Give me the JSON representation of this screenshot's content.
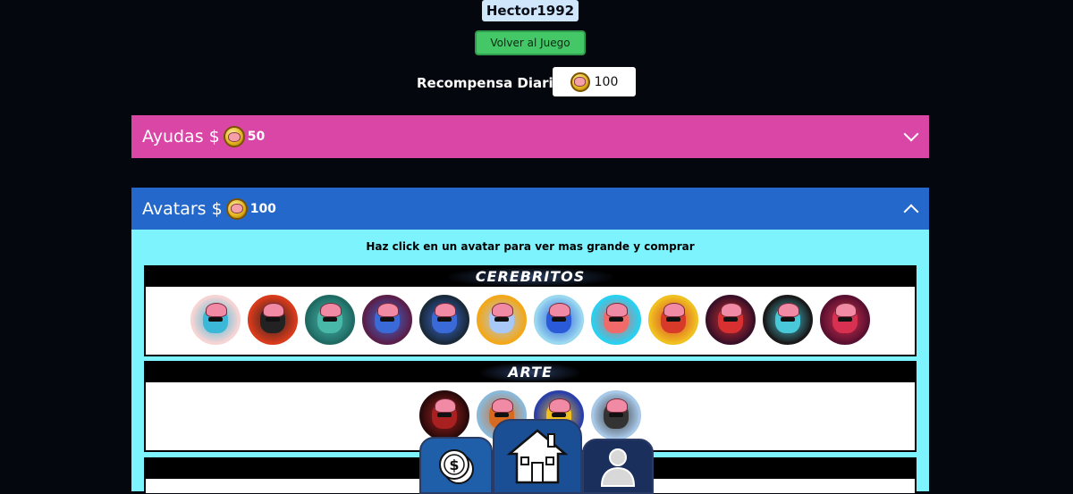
{
  "header": {
    "username": "Hector1992",
    "back_button": "Volver al Juego"
  },
  "daily_reward": {
    "label": "Recompensa Diaria:",
    "amount": "100",
    "icon": "brain-coin-icon"
  },
  "panels": [
    {
      "title": "Ayudas $",
      "price": "50",
      "state": "collapsed",
      "color": "#d946a6"
    },
    {
      "title": "Avatars $",
      "price": "100",
      "state": "expanded",
      "color": "#2468cc"
    }
  ],
  "avatars_panel": {
    "instruction": "Haz click en un avatar para ver mas grande y comprar",
    "categories": [
      {
        "title": "CEREBRITOS",
        "avatar_count": 12
      },
      {
        "title": "ARTE",
        "avatar_count": 4
      }
    ]
  },
  "dock": {
    "icons": [
      "dollar-coins-icon",
      "home-icon",
      "user-icon"
    ]
  },
  "colors": {
    "background": "#05070f",
    "ayudas": "#d946a6",
    "avatars": "#2468cc",
    "panel_body": "#7cf3fd",
    "back_button": "#44c767",
    "username_bg": "#cfe6fb"
  }
}
